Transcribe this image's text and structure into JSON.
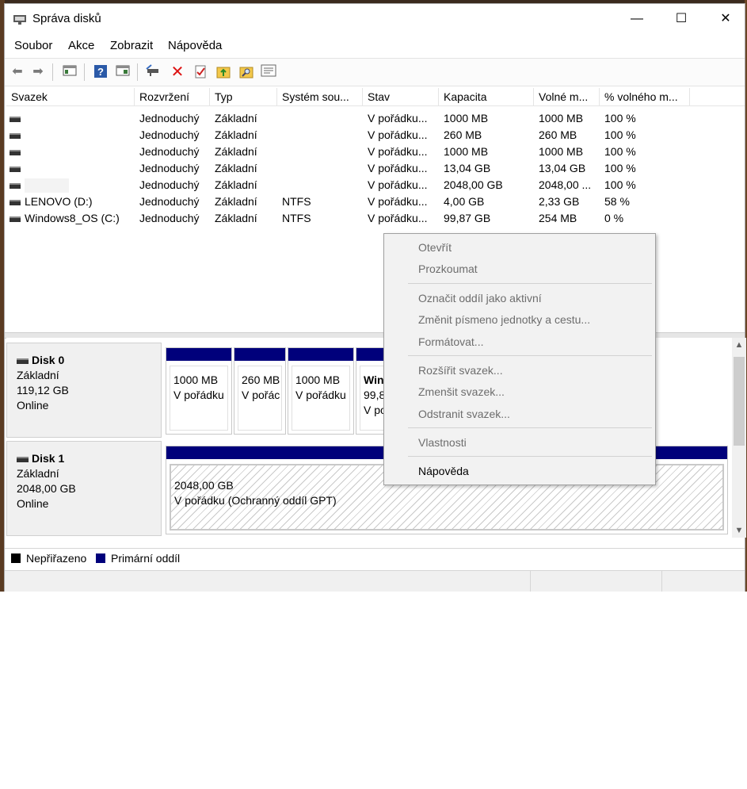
{
  "window": {
    "title": "Správa disků",
    "icon": "disk-management-icon"
  },
  "controls": {
    "minimize": "—",
    "maximize": "☐",
    "close": "✕"
  },
  "menu": [
    "Soubor",
    "Akce",
    "Zobrazit",
    "Nápověda"
  ],
  "toolbar_icons": [
    "back-arrow-icon",
    "forward-arrow-icon",
    "show-hide-console-icon",
    "help-icon",
    "properties-icon",
    "connect-drive-icon",
    "delete-icon",
    "check-icon",
    "up-folder-icon",
    "search-folder-icon",
    "list-icon"
  ],
  "columns": [
    "Svazek",
    "Rozvržení",
    "Typ",
    "Systém sou...",
    "Stav",
    "Kapacita",
    "Volné m...",
    "% volného m..."
  ],
  "rows": [
    {
      "volume": "",
      "layout": "Jednoduchý",
      "type": "Základní",
      "fs": "",
      "status": "V pořádku...",
      "capacity": "1000 MB",
      "free": "1000 MB",
      "pct": "100 %"
    },
    {
      "volume": "",
      "layout": "Jednoduchý",
      "type": "Základní",
      "fs": "",
      "status": "V pořádku...",
      "capacity": "260 MB",
      "free": "260 MB",
      "pct": "100 %"
    },
    {
      "volume": "",
      "layout": "Jednoduchý",
      "type": "Základní",
      "fs": "",
      "status": "V pořádku...",
      "capacity": "1000 MB",
      "free": "1000 MB",
      "pct": "100 %"
    },
    {
      "volume": "",
      "layout": "Jednoduchý",
      "type": "Základní",
      "fs": "",
      "status": "V pořádku...",
      "capacity": "13,04 GB",
      "free": "13,04 GB",
      "pct": "100 %"
    },
    {
      "volume": "",
      "layout": "Jednoduchý",
      "type": "Základní",
      "fs": "",
      "status": "V pořádku...",
      "capacity": "2048,00 GB",
      "free": "2048,00 ...",
      "pct": "100 %"
    },
    {
      "volume": "LENOVO (D:)",
      "layout": "Jednoduchý",
      "type": "Základní",
      "fs": "NTFS",
      "status": "V pořádku...",
      "capacity": "4,00 GB",
      "free": "2,33 GB",
      "pct": "58 %"
    },
    {
      "volume": "Windows8_OS (C:)",
      "layout": "Jednoduchý",
      "type": "Základní",
      "fs": "NTFS",
      "status": "V pořádku...",
      "capacity": "99,87 GB",
      "free": "254 MB",
      "pct": "0 %"
    }
  ],
  "disks": [
    {
      "name": "Disk 0",
      "type": "Základní",
      "size": "119,12 GB",
      "state": "Online",
      "partitions": [
        {
          "size": "1000 MB",
          "status": "V pořádku"
        },
        {
          "size": "260 MB",
          "status": "V pořác"
        },
        {
          "size": "1000 MB",
          "status": "V pořádku"
        },
        {
          "name": "Wind",
          "size": "99,87",
          "status": "V po"
        }
      ]
    },
    {
      "name": "Disk 1",
      "type": "Základní",
      "size": "2048,00 GB",
      "state": "Online",
      "partitions": [
        {
          "size": "2048,00 GB",
          "status": "V pořádku (Ochranný oddíl GPT)"
        }
      ]
    }
  ],
  "legend": [
    {
      "label": "Nepřiřazeno",
      "color": "#000000"
    },
    {
      "label": "Primární oddíl",
      "color": "#00007b"
    }
  ],
  "context_menu": [
    {
      "label": "Otevřít",
      "enabled": false
    },
    {
      "label": "Prozkoumat",
      "enabled": false
    },
    {
      "label": "Označit oddíl jako aktivní",
      "enabled": false
    },
    {
      "label": "Změnit písmeno jednotky a cestu...",
      "enabled": false
    },
    {
      "label": "Formátovat...",
      "enabled": false
    },
    {
      "label": "Rozšířit svazek...",
      "enabled": false
    },
    {
      "label": "Zmenšit svazek...",
      "enabled": false
    },
    {
      "label": "Odstranit svazek...",
      "enabled": false
    },
    {
      "label": "Vlastnosti",
      "enabled": false
    },
    {
      "label": "Nápověda",
      "enabled": true
    }
  ],
  "colors": {
    "primary_partition": "#00007b",
    "disabled_text": "#6d6d6d"
  }
}
